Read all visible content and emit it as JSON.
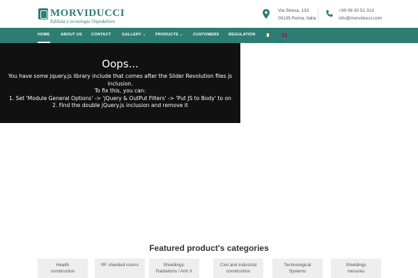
{
  "header": {
    "logo": {
      "name": "MORVIDUCCI",
      "tagline": "Edilizia e tecnologie Ospedaliere"
    },
    "address": {
      "line1": "Via Stresa, 133",
      "line2": "00135 Roma, Italia",
      "icon": "map-pin-icon"
    },
    "contact": {
      "phone": "+39 06 30 51 313",
      "email": "info@morviducci.com",
      "icon": "phone-icon"
    },
    "brand_color": "#2e7d72"
  },
  "nav": {
    "items": [
      {
        "label": "HOME",
        "active": true
      },
      {
        "label": "ABOUT US"
      },
      {
        "label": "CONTACT"
      },
      {
        "label": "GALLERY",
        "dropdown": true
      },
      {
        "label": "PRODUCTS",
        "dropdown": true
      },
      {
        "label": "CUSTOMERS"
      },
      {
        "label": "REGULATION"
      }
    ],
    "languages": [
      {
        "icon": "italy-flag-icon"
      },
      {
        "icon": "uk-flag-icon"
      }
    ]
  },
  "slider_error": {
    "title": "Oops...",
    "lines": [
      "You have some jquery.js library include that comes after the Slider Revolution files js",
      "inclusion.",
      "To fix this, you can:",
      "1. Set 'Module General Options' -> 'jQuery & OutPut Filters' -> 'Put JS to Body' to on",
      "2. Find the double jQuery.js inclusion and remove it"
    ]
  },
  "featured": {
    "title": "Featured product's categories",
    "categories": [
      "Health\nconstruction",
      "RF shielded rooms",
      "Shieldings:\nRadiations / Anti X",
      "Civil and Industrial\nconstruction",
      "Technological\nSystems",
      "Shieldings\nmesures"
    ]
  }
}
